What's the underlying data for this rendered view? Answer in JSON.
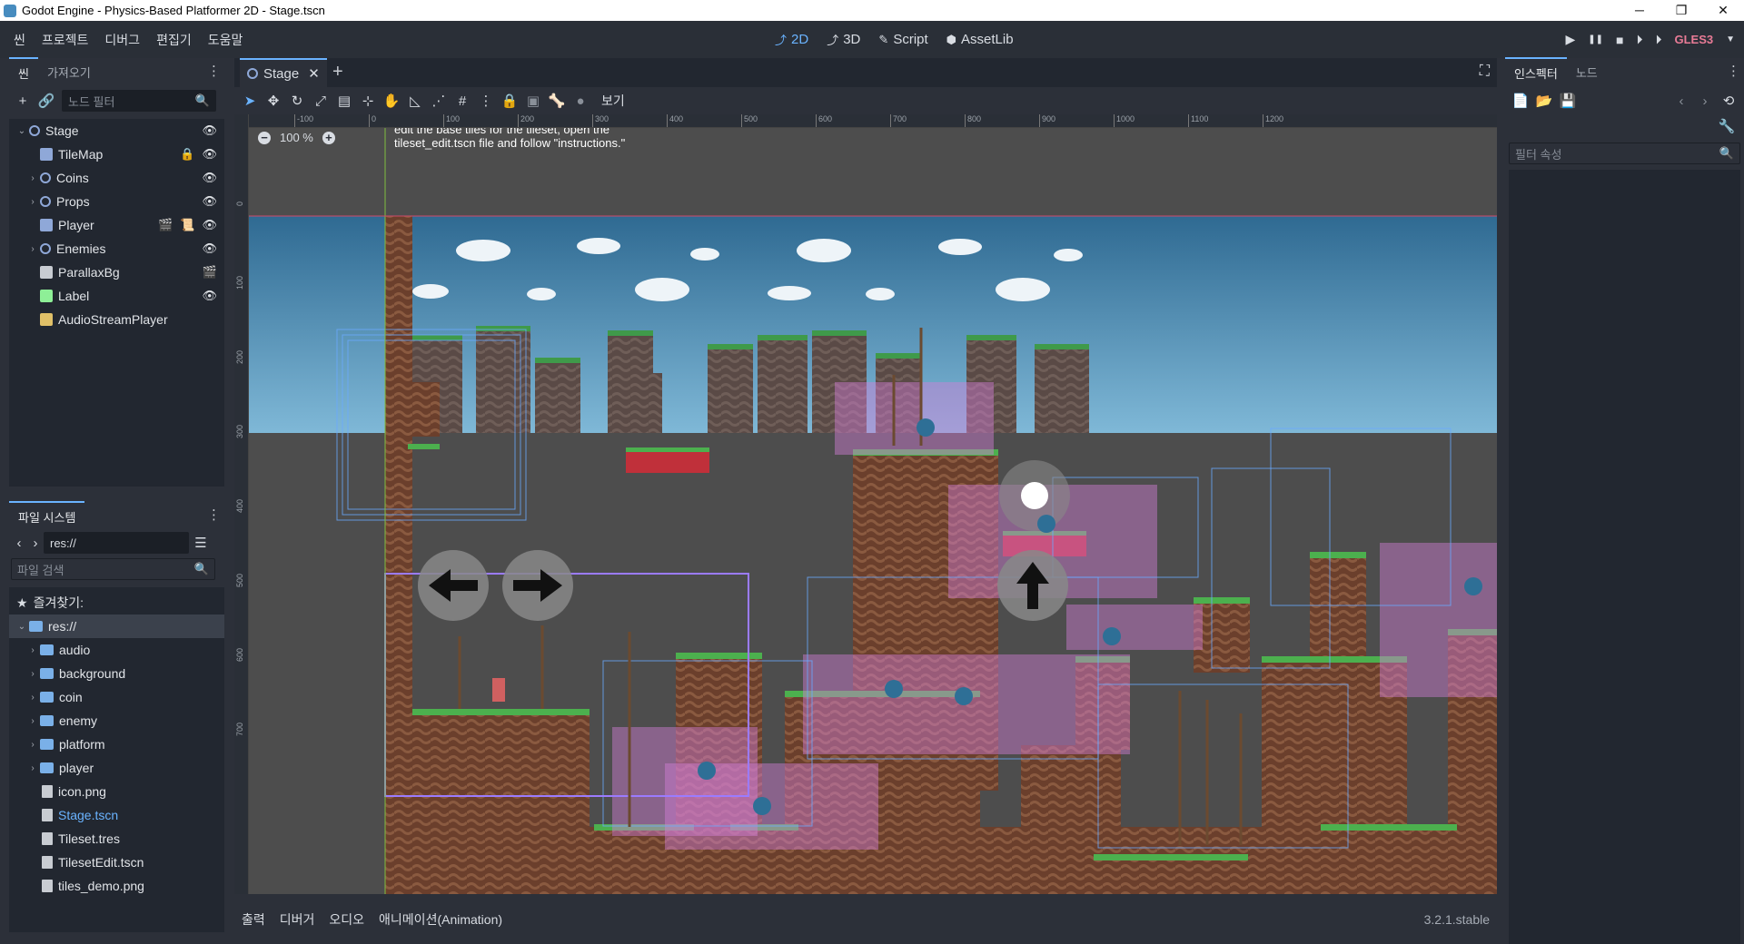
{
  "window": {
    "title": "Godot Engine - Physics-Based Platformer 2D - Stage.tscn",
    "minimize": "─",
    "maximize": "❐",
    "close": "✕"
  },
  "menu": [
    "씬",
    "프로젝트",
    "디버그",
    "편집기",
    "도움말"
  ],
  "workspace_tabs": [
    {
      "icon": "⤴",
      "label": "2D",
      "active": true
    },
    {
      "icon": "⤴",
      "label": "3D",
      "active": false
    },
    {
      "icon": "✎",
      "label": "Script",
      "active": false
    },
    {
      "icon": "⬢",
      "label": "AssetLib",
      "active": false
    }
  ],
  "play_controls": {
    "play": "▶",
    "pause": "❚❚",
    "stop": "■",
    "play_scene": "⏵",
    "play_custom": "⏵",
    "renderer": "GLES3"
  },
  "scene_dock": {
    "tabs": [
      "씬",
      "가져오기"
    ],
    "filter_placeholder": "노드 필터",
    "nodes": [
      {
        "name": "Stage",
        "depth": 0,
        "expanded": true,
        "icon": "node2d-icon",
        "color": "#8fa8d8",
        "right": [
          "👁"
        ]
      },
      {
        "name": "TileMap",
        "depth": 1,
        "expanded": false,
        "icon": "tilemap-icon",
        "color": "#8fa8d8",
        "right": [
          "🔒",
          "👁"
        ]
      },
      {
        "name": "Coins",
        "depth": 1,
        "expanded": false,
        "icon": "node2d-icon",
        "color": "#8fa8d8",
        "right": [
          "👁"
        ]
      },
      {
        "name": "Props",
        "depth": 1,
        "expanded": false,
        "icon": "node2d-icon",
        "color": "#8fa8d8",
        "right": [
          "👁"
        ]
      },
      {
        "name": "Player",
        "depth": 1,
        "expanded": false,
        "icon": "rigidbody-icon",
        "color": "#8fa8d8",
        "right": [
          "🎬",
          "📜",
          "👁"
        ]
      },
      {
        "name": "Enemies",
        "depth": 1,
        "expanded": false,
        "icon": "node2d-icon",
        "color": "#8fa8d8",
        "right": [
          "👁"
        ]
      },
      {
        "name": "ParallaxBg",
        "depth": 1,
        "expanded": false,
        "icon": "parallax-icon",
        "color": "#c8ccd2",
        "right": [
          "🎬"
        ]
      },
      {
        "name": "Label",
        "depth": 1,
        "expanded": false,
        "icon": "label-icon",
        "color": "#8eef97",
        "right": [
          "👁"
        ]
      },
      {
        "name": "AudioStreamPlayer",
        "depth": 1,
        "expanded": false,
        "icon": "audio-icon",
        "color": "#e0c068",
        "right": []
      }
    ]
  },
  "filesystem_dock": {
    "title": "파일 시스템",
    "path": "res://",
    "search_placeholder": "파일 검색",
    "favorites": "즐겨찾기:",
    "root": "res://",
    "items": [
      {
        "name": "audio",
        "type": "folder"
      },
      {
        "name": "background",
        "type": "folder"
      },
      {
        "name": "coin",
        "type": "folder"
      },
      {
        "name": "enemy",
        "type": "folder"
      },
      {
        "name": "platform",
        "type": "folder"
      },
      {
        "name": "player",
        "type": "folder"
      },
      {
        "name": "icon.png",
        "type": "file"
      },
      {
        "name": "Stage.tscn",
        "type": "scene",
        "highlight": true
      },
      {
        "name": "Tileset.tres",
        "type": "file"
      },
      {
        "name": "TilesetEdit.tscn",
        "type": "scene"
      },
      {
        "name": "tiles_demo.png",
        "type": "file"
      }
    ]
  },
  "viewport": {
    "tab": "Stage",
    "view_menu": "보기",
    "zoom": "100 %",
    "label_text": "edit the base tiles for the tileset, open the tileset_edit.tscn file and follow \"instructions.\"",
    "ruler_x": [
      "-100",
      "0",
      "100",
      "200",
      "300",
      "400",
      "500",
      "600",
      "700",
      "800",
      "900",
      "1000",
      "1100",
      "1200"
    ],
    "ruler_y": [
      "0",
      "100",
      "200",
      "300",
      "400",
      "500",
      "600",
      "700"
    ]
  },
  "bottom_panel": {
    "tabs": [
      "출력",
      "디버거",
      "오디오",
      "애니메이션(Animation)"
    ],
    "version": "3.2.1.stable"
  },
  "inspector": {
    "tabs": [
      "인스펙터",
      "노드"
    ],
    "filter_placeholder": "필터 속성"
  },
  "colors": {
    "accent": "#6ab3ff",
    "bg": "#2c3039",
    "panel": "#222730",
    "gles": "#e87b96"
  }
}
